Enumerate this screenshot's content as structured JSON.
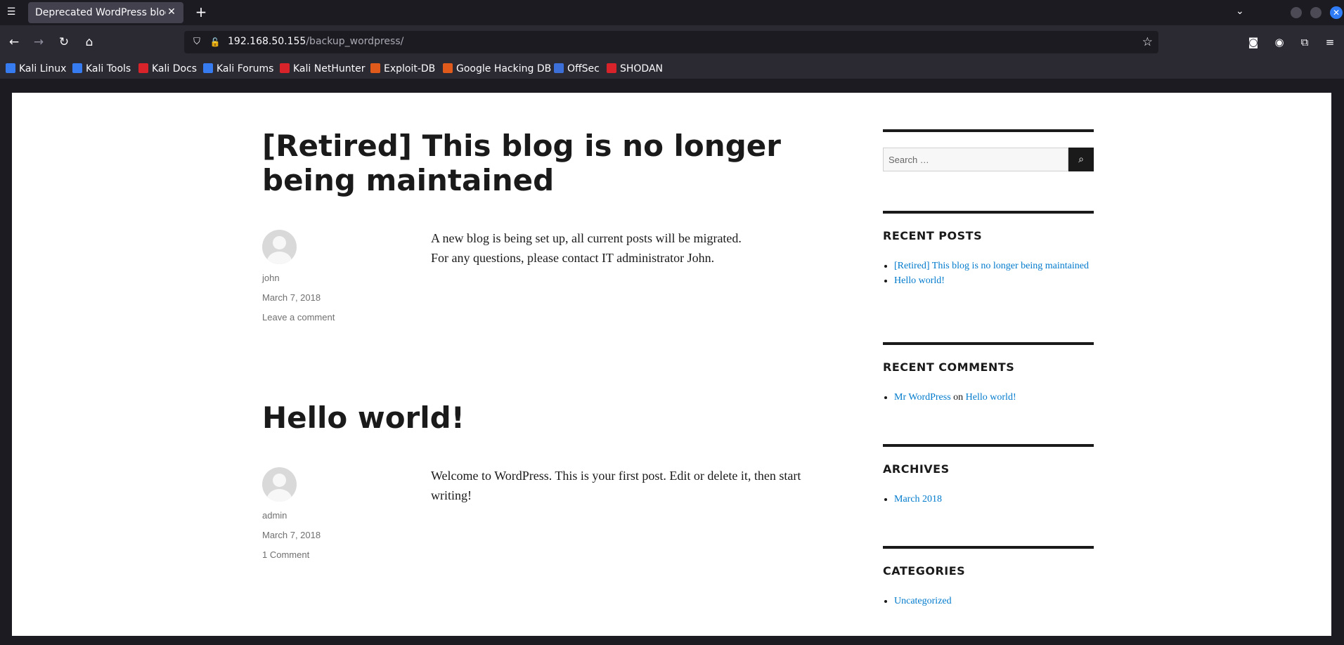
{
  "browser": {
    "tab_title": "Deprecated WordPress blog",
    "url_host": "192.168.50.155",
    "url_path": "/backup_wordpress/",
    "bookmarks": [
      {
        "label": "Kali Linux",
        "icon": "kali-dragon-icon",
        "color": "#367bf0"
      },
      {
        "label": "Kali Tools",
        "icon": "kali-tools-icon",
        "color": "#367bf0"
      },
      {
        "label": "Kali Docs",
        "icon": "kali-docs-icon",
        "color": "#d8232a"
      },
      {
        "label": "Kali Forums",
        "icon": "kali-dragon-icon",
        "color": "#367bf0"
      },
      {
        "label": "Kali NetHunter",
        "icon": "nethunter-icon",
        "color": "#d8232a"
      },
      {
        "label": "Exploit-DB",
        "icon": "exploit-db-icon",
        "color": "#e05a1c"
      },
      {
        "label": "Google Hacking DB",
        "icon": "exploit-db-icon",
        "color": "#e05a1c"
      },
      {
        "label": "OffSec",
        "icon": "offsec-icon",
        "color": "#3d6fd8"
      },
      {
        "label": "SHODAN",
        "icon": "shodan-icon",
        "color": "#d8232a"
      }
    ]
  },
  "posts": [
    {
      "title": "[Retired] This blog is no longer being maintained",
      "author": "john",
      "date": "March 7, 2018",
      "comments": "Leave a comment",
      "content": [
        "A new blog is being set up, all current posts will be migrated.",
        "For any questions, please contact IT administrator John."
      ]
    },
    {
      "title": "Hello world!",
      "author": "admin",
      "date": "March 7, 2018",
      "comments": "1 Comment",
      "content": [
        "Welcome to WordPress. This is your first post. Edit or delete it, then start writing!"
      ]
    }
  ],
  "sidebar": {
    "search_placeholder": "Search …",
    "recent_posts": {
      "title": "RECENT POSTS",
      "items": [
        "[Retired] This blog is no longer being maintained",
        "Hello world!"
      ]
    },
    "recent_comments": {
      "title": "RECENT COMMENTS",
      "author": "Mr WordPress",
      "on": "on",
      "post": "Hello world!"
    },
    "archives": {
      "title": "ARCHIVES",
      "items": [
        "March 2018"
      ]
    },
    "categories": {
      "title": "CATEGORIES",
      "items": [
        "Uncategorized"
      ]
    }
  },
  "colors": {
    "link": "#007acc",
    "text": "#1a1a1a",
    "meta": "#707070"
  }
}
